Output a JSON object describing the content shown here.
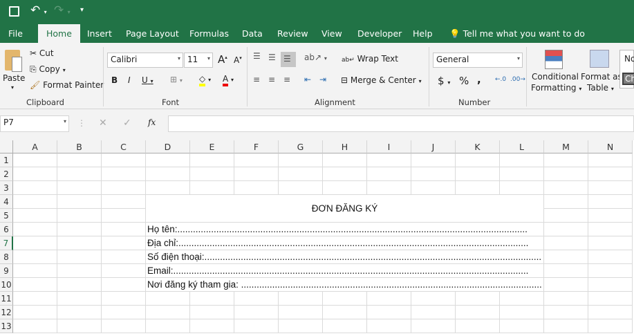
{
  "qat": {
    "icons": [
      "save-icon",
      "undo-icon",
      "redo-icon",
      "customize-icon"
    ]
  },
  "tabs": [
    "File",
    "Home",
    "Insert",
    "Page Layout",
    "Formulas",
    "Data",
    "Review",
    "View",
    "Developer",
    "Help"
  ],
  "tell_me": "Tell me what you want to do",
  "clipboard": {
    "paste": "Paste",
    "cut": "Cut",
    "copy": "Copy",
    "format_painter": "Format Painter",
    "label": "Clipboard"
  },
  "font": {
    "name": "Calibri",
    "size": "11",
    "label": "Font",
    "bold": "B",
    "italic": "I",
    "underline": "U"
  },
  "alignment": {
    "wrap_text": "Wrap Text",
    "merge_center": "Merge & Center",
    "label": "Alignment"
  },
  "number": {
    "format": "General",
    "currency": "$",
    "percent": "%",
    "comma": ",",
    "label": "Number"
  },
  "styles": {
    "conditional": "Conditional",
    "conditional2": "Formatting",
    "format_as": "Format as",
    "table": "Table",
    "normal": "No",
    "check": "Ch"
  },
  "formula_bar": {
    "name_box": "P7",
    "fx": "fx",
    "value": ""
  },
  "columns": [
    "A",
    "B",
    "C",
    "D",
    "E",
    "F",
    "G",
    "H",
    "I",
    "J",
    "K",
    "L",
    "M",
    "N"
  ],
  "rows": [
    "1",
    "2",
    "3",
    "4",
    "5",
    "6",
    "7",
    "8",
    "9",
    "10",
    "11",
    "12",
    "13"
  ],
  "sheet": {
    "title": "ĐƠN ĐĂNG KÝ",
    "fields": [
      "Họ tên:.......................................................................................................................................",
      "Địa chỉ:.......................................................................................................................................",
      "Số điện thoại:..................................................................................................................................",
      "Email:.........................................................................................................................................",
      "Nơi đăng ký tham gia: ........................................................................................................................"
    ]
  },
  "colors": {
    "brand": "#217346",
    "selected_row_header": "#217346"
  }
}
